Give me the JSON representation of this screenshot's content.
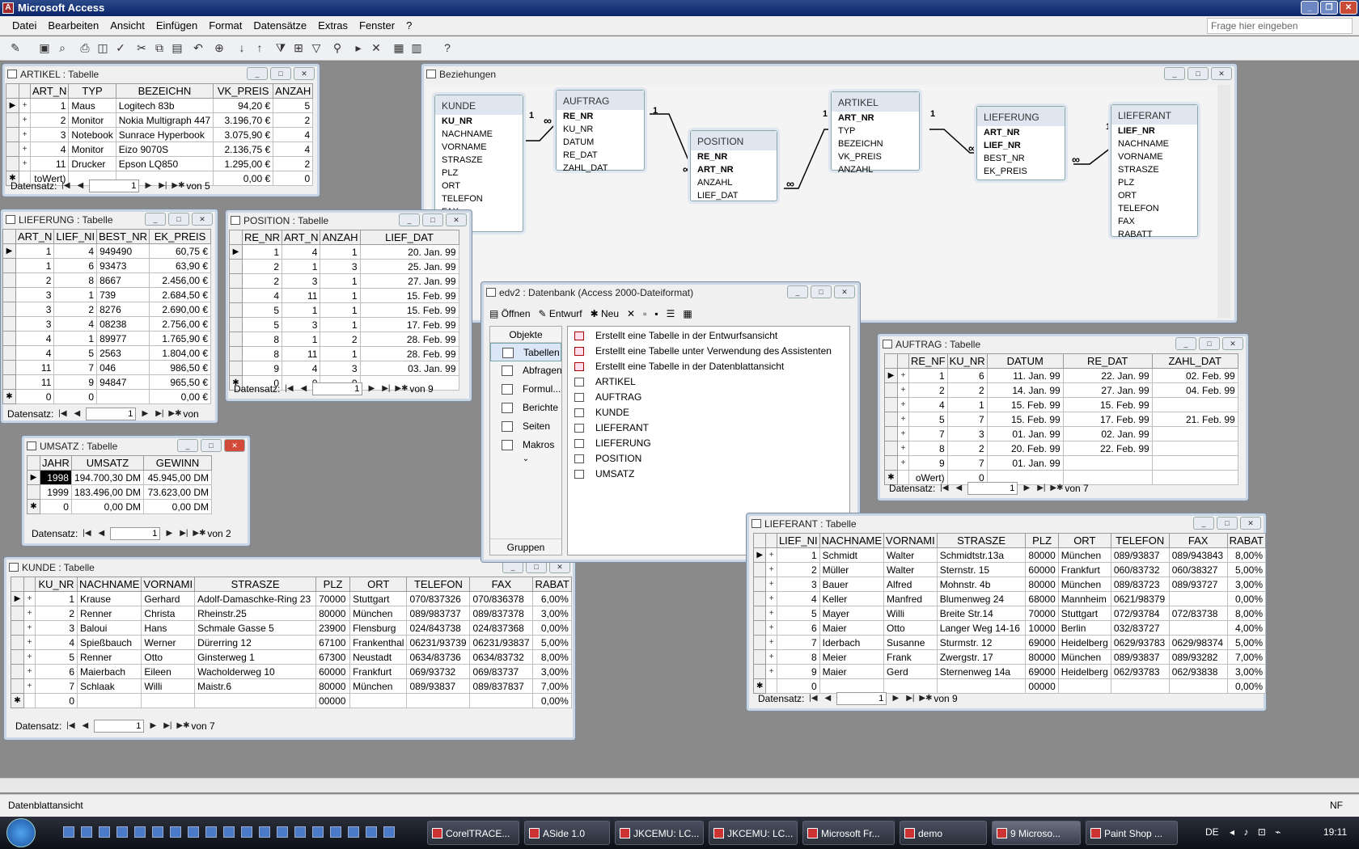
{
  "app": {
    "title": "Microsoft Access"
  },
  "menu": [
    "Datei",
    "Bearbeiten",
    "Ansicht",
    "Einfügen",
    "Format",
    "Datensätze",
    "Extras",
    "Fenster",
    "?"
  ],
  "help_placeholder": "Frage hier eingeben",
  "nav_label": "Datensatz:",
  "artikel": {
    "title": "ARTIKEL : Tabelle",
    "headers": [
      "ART_N",
      "TYP",
      "BEZEICHN",
      "VK_PREIS",
      "ANZAH"
    ],
    "rows": [
      [
        "1",
        "Maus",
        "Logitech 83b",
        "94,20 €",
        "5"
      ],
      [
        "2",
        "Monitor",
        "Nokia Multigraph 447",
        "3.196,70 €",
        "2"
      ],
      [
        "3",
        "Notebook",
        "Sunrace Hyperbook",
        "3.075,90 €",
        "4"
      ],
      [
        "4",
        "Monitor",
        "Eizo 9070S",
        "2.136,75 €",
        "4"
      ],
      [
        "11",
        "Drucker",
        "Epson LQ850",
        "1.295,00 €",
        "2"
      ]
    ],
    "newrow": [
      "toWert)",
      "",
      "",
      "0,00 €",
      "0"
    ],
    "rec": "1",
    "of": "von  5"
  },
  "lieferung": {
    "title": "LIEFERUNG : Tabelle",
    "headers": [
      "ART_N",
      "LIEF_NI",
      "BEST_NR",
      "EK_PREIS"
    ],
    "rows": [
      [
        "1",
        "4",
        "949490",
        "60,75 €"
      ],
      [
        "1",
        "6",
        "93473",
        "63,90 €"
      ],
      [
        "2",
        "8",
        "8667",
        "2.456,00 €"
      ],
      [
        "3",
        "1",
        "739",
        "2.684,50 €"
      ],
      [
        "3",
        "2",
        "8276",
        "2.690,00 €"
      ],
      [
        "3",
        "4",
        "08238",
        "2.756,00 €"
      ],
      [
        "4",
        "1",
        "89977",
        "1.765,90 €"
      ],
      [
        "4",
        "5",
        "2563",
        "1.804,00 €"
      ],
      [
        "11",
        "7",
        "046",
        "986,50 €"
      ],
      [
        "11",
        "9",
        "94847",
        "965,50 €"
      ]
    ],
    "newrow": [
      "0",
      "0",
      "",
      "0,00 €"
    ],
    "rec": "1",
    "of": "von"
  },
  "position": {
    "title": "POSITION : Tabelle",
    "headers": [
      "RE_NR",
      "ART_N",
      "ANZAH",
      "LIEF_DAT"
    ],
    "rows": [
      [
        "1",
        "4",
        "1",
        "20. Jan. 99"
      ],
      [
        "2",
        "1",
        "3",
        "25. Jan. 99"
      ],
      [
        "2",
        "3",
        "1",
        "27. Jan. 99"
      ],
      [
        "4",
        "11",
        "1",
        "15. Feb. 99"
      ],
      [
        "5",
        "1",
        "1",
        "15. Feb. 99"
      ],
      [
        "5",
        "3",
        "1",
        "17. Feb. 99"
      ],
      [
        "8",
        "1",
        "2",
        "28. Feb. 99"
      ],
      [
        "8",
        "11",
        "1",
        "28. Feb. 99"
      ],
      [
        "9",
        "4",
        "3",
        "03. Jan. 99"
      ]
    ],
    "newrow": [
      "0",
      "0",
      "0",
      ""
    ],
    "rec": "1",
    "of": "von  9"
  },
  "umsatz": {
    "title": "UMSATZ : Tabelle",
    "headers": [
      "JAHR",
      "UMSATZ",
      "GEWINN"
    ],
    "rows": [
      [
        "1998",
        "194.700,30 DM",
        "45.945,00 DM"
      ],
      [
        "1999",
        "183.496,00 DM",
        "73.623,00 DM"
      ]
    ],
    "newrow": [
      "0",
      "0,00 DM",
      "0,00 DM"
    ],
    "rec": "1",
    "of": "von  2"
  },
  "kunde": {
    "title": "KUNDE : Tabelle",
    "headers": [
      "KU_NR",
      "NACHNAME",
      "VORNAMI",
      "STRASZE",
      "PLZ",
      "ORT",
      "TELEFON",
      "FAX",
      "RABAT"
    ],
    "rows": [
      [
        "1",
        "Krause",
        "Gerhard",
        "Adolf-Damaschke-Ring 23",
        "70000",
        "Stuttgart",
        "070/837326",
        "070/836378",
        "6,00%"
      ],
      [
        "2",
        "Renner",
        "Christa",
        "Rheinstr.25",
        "80000",
        "München",
        "089/983737",
        "089/837378",
        "3,00%"
      ],
      [
        "3",
        "Baloui",
        "Hans",
        "Schmale Gasse 5",
        "23900",
        "Flensburg",
        "024/843738",
        "024/837368",
        "0,00%"
      ],
      [
        "4",
        "Spießbauch",
        "Werner",
        "Dürerring 12",
        "67100",
        "Frankenthal",
        "06231/93739",
        "06231/93837",
        "5,00%"
      ],
      [
        "5",
        "Renner",
        "Otto",
        "Ginsterweg 1",
        "67300",
        "Neustadt",
        "0634/83736",
        "0634/83732",
        "8,00%"
      ],
      [
        "6",
        "Maierbach",
        "Eileen",
        "Wacholderweg 10",
        "60000",
        "Frankfurt",
        "069/93732",
        "069/83737",
        "3,00%"
      ],
      [
        "7",
        "Schlaak",
        "Willi",
        "Maistr.6",
        "80000",
        "München",
        "089/93837",
        "089/837837",
        "7,00%"
      ]
    ],
    "newrow": [
      "0",
      "",
      "",
      "",
      "00000",
      "",
      "",
      "",
      "0,00%"
    ],
    "rec": "1",
    "of": "von  7"
  },
  "auftrag": {
    "title": "AUFTRAG : Tabelle",
    "headers": [
      "RE_NF",
      "KU_NR",
      "DATUM",
      "RE_DAT",
      "ZAHL_DAT"
    ],
    "rows": [
      [
        "1",
        "6",
        "11. Jan. 99",
        "22. Jan. 99",
        "02. Feb. 99"
      ],
      [
        "2",
        "2",
        "14. Jan. 99",
        "27. Jan. 99",
        "04. Feb. 99"
      ],
      [
        "4",
        "1",
        "15. Feb. 99",
        "15. Feb. 99",
        ""
      ],
      [
        "5",
        "7",
        "15. Feb. 99",
        "17. Feb. 99",
        "21. Feb. 99"
      ],
      [
        "7",
        "3",
        "01. Jan. 99",
        "02. Jan. 99",
        ""
      ],
      [
        "8",
        "2",
        "20. Feb. 99",
        "22. Feb. 99",
        ""
      ],
      [
        "9",
        "7",
        "01. Jan. 99",
        "",
        ""
      ]
    ],
    "newrow": [
      "oWert)",
      "0",
      "",
      "",
      ""
    ],
    "rec": "1",
    "of": "von  7"
  },
  "lieferant": {
    "title": "LIEFERANT : Tabelle",
    "headers": [
      "LIEF_NI",
      "NACHNAME",
      "VORNAMI",
      "STRASZE",
      "PLZ",
      "ORT",
      "TELEFON",
      "FAX",
      "RABAT"
    ],
    "rows": [
      [
        "1",
        "Schmidt",
        "Walter",
        "Schmidtstr.13a",
        "80000",
        "München",
        "089/93837",
        "089/943843",
        "8,00%"
      ],
      [
        "2",
        "Müller",
        "Walter",
        "Sternstr. 15",
        "60000",
        "Frankfurt",
        "060/83732",
        "060/38327",
        "5,00%"
      ],
      [
        "3",
        "Bauer",
        "Alfred",
        "Mohnstr. 4b",
        "80000",
        "München",
        "089/83723",
        "089/93727",
        "3,00%"
      ],
      [
        "4",
        "Keller",
        "Manfred",
        "Blumenweg 24",
        "68000",
        "Mannheim",
        "0621/98379",
        "",
        "0,00%"
      ],
      [
        "5",
        "Mayer",
        "Willi",
        "Breite Str.14",
        "70000",
        "Stuttgart",
        "072/93784",
        "072/83738",
        "8,00%"
      ],
      [
        "6",
        "Maier",
        "Otto",
        "Langer Weg 14-16",
        "10000",
        "Berlin",
        "032/83727",
        "",
        "4,00%"
      ],
      [
        "7",
        "Iderbach",
        "Susanne",
        "Sturmstr. 12",
        "69000",
        "Heidelberg",
        "0629/93783",
        "0629/98374",
        "5,00%"
      ],
      [
        "8",
        "Meier",
        "Frank",
        "Zwergstr. 17",
        "80000",
        "München",
        "089/93837",
        "089/93282",
        "7,00%"
      ],
      [
        "9",
        "Maier",
        "Gerd",
        "Sternenweg 14a",
        "69000",
        "Heidelberg",
        "062/93783",
        "062/93838",
        "3,00%"
      ]
    ],
    "newrow": [
      "0",
      "",
      "",
      "",
      "00000",
      "",
      "",
      "",
      "0,00%"
    ],
    "rec": "1",
    "of": "von  9"
  },
  "beziehungen": {
    "title": "Beziehungen",
    "tables": [
      {
        "name": "KUNDE",
        "fields": [
          "KU_NR",
          "NACHNAME",
          "VORNAME",
          "STRASZE",
          "PLZ",
          "ORT",
          "TELEFON",
          "FAX"
        ],
        "pk": 1
      },
      {
        "name": "AUFTRAG",
        "fields": [
          "RE_NR",
          "KU_NR",
          "DATUM",
          "RE_DAT",
          "ZAHL_DAT"
        ],
        "pk": 1
      },
      {
        "name": "POSITION",
        "fields": [
          "RE_NR",
          "ART_NR",
          "ANZAHL",
          "LIEF_DAT"
        ],
        "pk": 2
      },
      {
        "name": "ARTIKEL",
        "fields": [
          "ART_NR",
          "TYP",
          "BEZEICHN",
          "VK_PREIS",
          "ANZAHL"
        ],
        "pk": 1
      },
      {
        "name": "LIEFERUNG",
        "fields": [
          "ART_NR",
          "LIEF_NR",
          "BEST_NR",
          "EK_PREIS"
        ],
        "pk": 2
      },
      {
        "name": "LIEFERANT",
        "fields": [
          "LIEF_NR",
          "NACHNAME",
          "VORNAME",
          "STRASZE",
          "PLZ",
          "ORT",
          "TELEFON",
          "FAX",
          "RABATT"
        ],
        "pk": 1
      }
    ],
    "one": "1",
    "many": "∞"
  },
  "dbwin": {
    "title": "edv2 : Datenbank (Access 2000-Dateiformat)",
    "toolbar": {
      "open": "Öffnen",
      "design": "Entwurf",
      "new": "Neu"
    },
    "objects_header": "Objekte",
    "groups_header": "Gruppen",
    "groups": [
      "Tabellen",
      "Abfragen",
      "Formul...",
      "Berichte",
      "Seiten",
      "Makros"
    ],
    "items": [
      {
        "label": "Erstellt eine Tabelle in der Entwurfsansicht",
        "wizard": true
      },
      {
        "label": "Erstellt eine Tabelle unter Verwendung des Assistenten",
        "wizard": true
      },
      {
        "label": "Erstellt eine Tabelle in der Datenblattansicht",
        "wizard": true
      },
      {
        "label": "ARTIKEL",
        "wizard": false
      },
      {
        "label": "AUFTRAG",
        "wizard": false
      },
      {
        "label": "KUNDE",
        "wizard": false
      },
      {
        "label": "LIEFERANT",
        "wizard": false
      },
      {
        "label": "LIEFERUNG",
        "wizard": false
      },
      {
        "label": "POSITION",
        "wizard": false
      },
      {
        "label": "UMSATZ",
        "wizard": false
      }
    ]
  },
  "status": {
    "left": "Datenblattansicht",
    "right": "NF"
  },
  "taskbar": {
    "items": [
      "CorelTRACE...",
      "ASide 1.0",
      "JKCEMU: LC...",
      "JKCEMU: LC...",
      "Microsoft Fr...",
      "demo",
      "9 Microso...",
      "Paint Shop ..."
    ],
    "lang": "DE",
    "clock": "19:11"
  }
}
